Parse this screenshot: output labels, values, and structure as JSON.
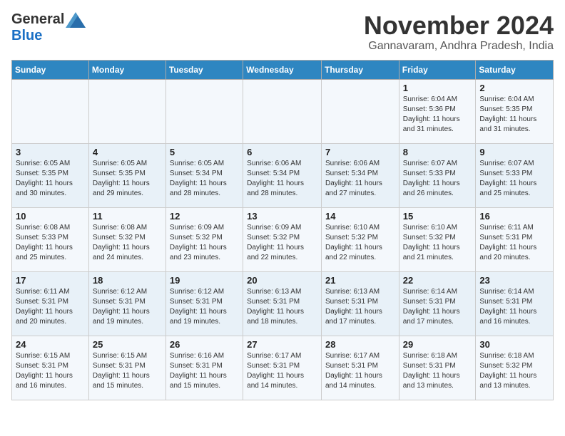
{
  "header": {
    "logo_general": "General",
    "logo_blue": "Blue",
    "month_year": "November 2024",
    "location": "Gannavaram, Andhra Pradesh, India"
  },
  "weekdays": [
    "Sunday",
    "Monday",
    "Tuesday",
    "Wednesday",
    "Thursday",
    "Friday",
    "Saturday"
  ],
  "weeks": [
    [
      {
        "day": "",
        "info": ""
      },
      {
        "day": "",
        "info": ""
      },
      {
        "day": "",
        "info": ""
      },
      {
        "day": "",
        "info": ""
      },
      {
        "day": "",
        "info": ""
      },
      {
        "day": "1",
        "info": "Sunrise: 6:04 AM\nSunset: 5:36 PM\nDaylight: 11 hours and 31 minutes."
      },
      {
        "day": "2",
        "info": "Sunrise: 6:04 AM\nSunset: 5:35 PM\nDaylight: 11 hours and 31 minutes."
      }
    ],
    [
      {
        "day": "3",
        "info": "Sunrise: 6:05 AM\nSunset: 5:35 PM\nDaylight: 11 hours and 30 minutes."
      },
      {
        "day": "4",
        "info": "Sunrise: 6:05 AM\nSunset: 5:35 PM\nDaylight: 11 hours and 29 minutes."
      },
      {
        "day": "5",
        "info": "Sunrise: 6:05 AM\nSunset: 5:34 PM\nDaylight: 11 hours and 28 minutes."
      },
      {
        "day": "6",
        "info": "Sunrise: 6:06 AM\nSunset: 5:34 PM\nDaylight: 11 hours and 28 minutes."
      },
      {
        "day": "7",
        "info": "Sunrise: 6:06 AM\nSunset: 5:34 PM\nDaylight: 11 hours and 27 minutes."
      },
      {
        "day": "8",
        "info": "Sunrise: 6:07 AM\nSunset: 5:33 PM\nDaylight: 11 hours and 26 minutes."
      },
      {
        "day": "9",
        "info": "Sunrise: 6:07 AM\nSunset: 5:33 PM\nDaylight: 11 hours and 25 minutes."
      }
    ],
    [
      {
        "day": "10",
        "info": "Sunrise: 6:08 AM\nSunset: 5:33 PM\nDaylight: 11 hours and 25 minutes."
      },
      {
        "day": "11",
        "info": "Sunrise: 6:08 AM\nSunset: 5:32 PM\nDaylight: 11 hours and 24 minutes."
      },
      {
        "day": "12",
        "info": "Sunrise: 6:09 AM\nSunset: 5:32 PM\nDaylight: 11 hours and 23 minutes."
      },
      {
        "day": "13",
        "info": "Sunrise: 6:09 AM\nSunset: 5:32 PM\nDaylight: 11 hours and 22 minutes."
      },
      {
        "day": "14",
        "info": "Sunrise: 6:10 AM\nSunset: 5:32 PM\nDaylight: 11 hours and 22 minutes."
      },
      {
        "day": "15",
        "info": "Sunrise: 6:10 AM\nSunset: 5:32 PM\nDaylight: 11 hours and 21 minutes."
      },
      {
        "day": "16",
        "info": "Sunrise: 6:11 AM\nSunset: 5:31 PM\nDaylight: 11 hours and 20 minutes."
      }
    ],
    [
      {
        "day": "17",
        "info": "Sunrise: 6:11 AM\nSunset: 5:31 PM\nDaylight: 11 hours and 20 minutes."
      },
      {
        "day": "18",
        "info": "Sunrise: 6:12 AM\nSunset: 5:31 PM\nDaylight: 11 hours and 19 minutes."
      },
      {
        "day": "19",
        "info": "Sunrise: 6:12 AM\nSunset: 5:31 PM\nDaylight: 11 hours and 19 minutes."
      },
      {
        "day": "20",
        "info": "Sunrise: 6:13 AM\nSunset: 5:31 PM\nDaylight: 11 hours and 18 minutes."
      },
      {
        "day": "21",
        "info": "Sunrise: 6:13 AM\nSunset: 5:31 PM\nDaylight: 11 hours and 17 minutes."
      },
      {
        "day": "22",
        "info": "Sunrise: 6:14 AM\nSunset: 5:31 PM\nDaylight: 11 hours and 17 minutes."
      },
      {
        "day": "23",
        "info": "Sunrise: 6:14 AM\nSunset: 5:31 PM\nDaylight: 11 hours and 16 minutes."
      }
    ],
    [
      {
        "day": "24",
        "info": "Sunrise: 6:15 AM\nSunset: 5:31 PM\nDaylight: 11 hours and 16 minutes."
      },
      {
        "day": "25",
        "info": "Sunrise: 6:15 AM\nSunset: 5:31 PM\nDaylight: 11 hours and 15 minutes."
      },
      {
        "day": "26",
        "info": "Sunrise: 6:16 AM\nSunset: 5:31 PM\nDaylight: 11 hours and 15 minutes."
      },
      {
        "day": "27",
        "info": "Sunrise: 6:17 AM\nSunset: 5:31 PM\nDaylight: 11 hours and 14 minutes."
      },
      {
        "day": "28",
        "info": "Sunrise: 6:17 AM\nSunset: 5:31 PM\nDaylight: 11 hours and 14 minutes."
      },
      {
        "day": "29",
        "info": "Sunrise: 6:18 AM\nSunset: 5:31 PM\nDaylight: 11 hours and 13 minutes."
      },
      {
        "day": "30",
        "info": "Sunrise: 6:18 AM\nSunset: 5:32 PM\nDaylight: 11 hours and 13 minutes."
      }
    ]
  ]
}
